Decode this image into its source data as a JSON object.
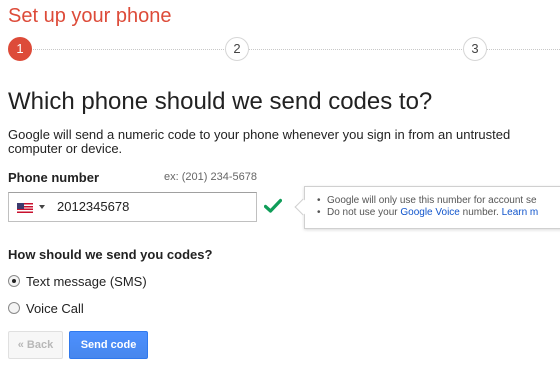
{
  "page": {
    "title": "Set up your phone"
  },
  "stepper": {
    "steps": [
      {
        "label": "1",
        "state": "active"
      },
      {
        "label": "2",
        "state": "inactive"
      },
      {
        "label": "3",
        "state": "inactive"
      }
    ]
  },
  "main": {
    "heading": "Which phone should we send codes to?",
    "description": "Google will send a numeric code to your phone whenever you sign in from an untrusted computer or device.",
    "phone": {
      "label": "Phone number",
      "example": "ex: (201) 234-5678",
      "country_flag": "us-flag-icon",
      "value": "2012345678",
      "valid_icon": "checkmark-icon"
    },
    "tooltip": {
      "line1": "Google will only use this number for account se",
      "line2_prefix": "Do not use your ",
      "line2_link": "Google Voice",
      "line2_suffix": " number. ",
      "line2_more": "Learn m"
    },
    "method": {
      "question": "How should we send you codes?",
      "options": [
        {
          "label": "Text message (SMS)",
          "checked": true
        },
        {
          "label": "Voice Call",
          "checked": false
        }
      ]
    },
    "buttons": {
      "back_label": "« Back",
      "send_label": "Send code"
    }
  },
  "colors": {
    "title_red": "#dd4b39",
    "step_active": "#dd4b39",
    "check_green": "#109d59",
    "link_blue": "#1155cc",
    "primary_button": "#4d90fe"
  }
}
